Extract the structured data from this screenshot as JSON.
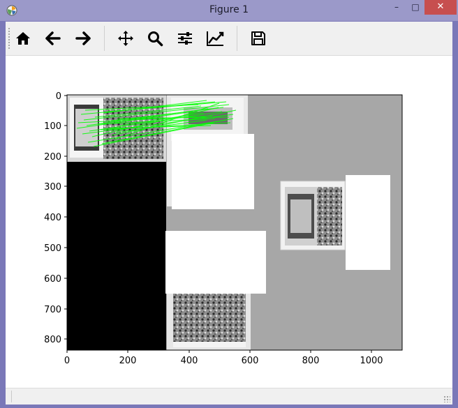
{
  "window": {
    "title": "Figure 1",
    "app_icon": "matplotlib-icon",
    "controls": {
      "minimize": "–",
      "maximize": "□",
      "close": "✕"
    }
  },
  "toolbar": {
    "buttons": [
      {
        "name": "home-button",
        "icon": "home-icon"
      },
      {
        "name": "back-button",
        "icon": "arrow-left-icon"
      },
      {
        "name": "forward-button",
        "icon": "arrow-right-icon"
      },
      {
        "name": "pan-button",
        "icon": "move-icon"
      },
      {
        "name": "zoom-button",
        "icon": "magnifier-icon"
      },
      {
        "name": "configure-subplots-button",
        "icon": "sliders-icon"
      },
      {
        "name": "edit-axis-button",
        "icon": "line-chart-icon"
      },
      {
        "name": "save-button",
        "icon": "floppy-disk-icon"
      }
    ]
  },
  "plot": {
    "x_ticks": [
      "0",
      "200",
      "400",
      "600",
      "800",
      "1000"
    ],
    "y_ticks": [
      "0",
      "100",
      "200",
      "300",
      "400",
      "500",
      "600",
      "700",
      "800"
    ],
    "xlim": [
      0,
      1100
    ],
    "ylim": [
      840,
      0
    ],
    "colors": {
      "background": "#a7a7a7",
      "black_region": "#000000",
      "white_region": "#ffffff",
      "match_lines": "#00ff00"
    }
  },
  "statusbar": {
    "message": ""
  }
}
